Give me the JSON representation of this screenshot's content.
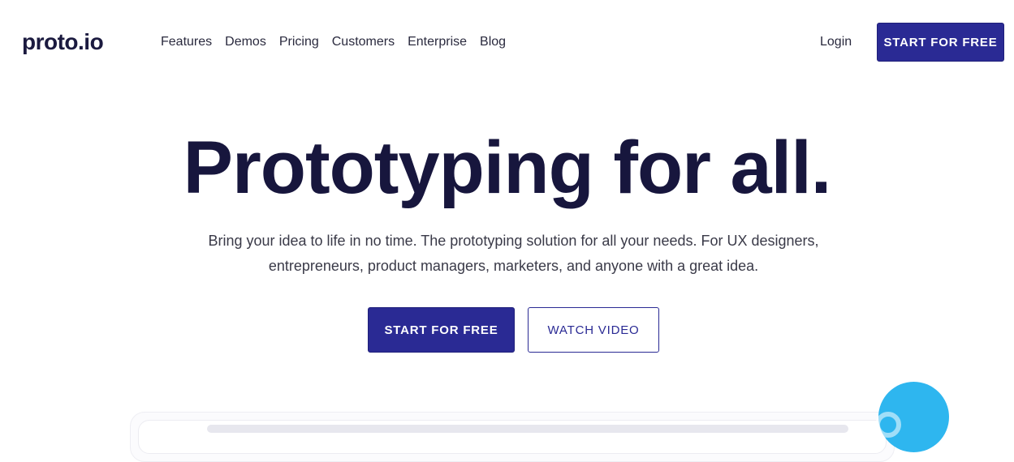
{
  "brand": {
    "logo_text": "proto.io"
  },
  "nav": {
    "items": [
      "Features",
      "Demos",
      "Pricing",
      "Customers",
      "Enterprise",
      "Blog"
    ],
    "login_label": "Login",
    "cta_label": "START FOR FREE"
  },
  "hero": {
    "title": "Prototyping for all.",
    "subtitle_line1": "Bring your idea to life in no time. The prototyping solution for all your needs. For UX designers,",
    "subtitle_line2": "entrepreneurs, product managers, marketers, and anyone with a great idea.",
    "primary_cta": "START FOR FREE",
    "secondary_cta": "WATCH VIDEO"
  },
  "colors": {
    "primary": "#2a2a94",
    "heading": "#17163d",
    "accent_bubble": "#2eb6ef"
  }
}
